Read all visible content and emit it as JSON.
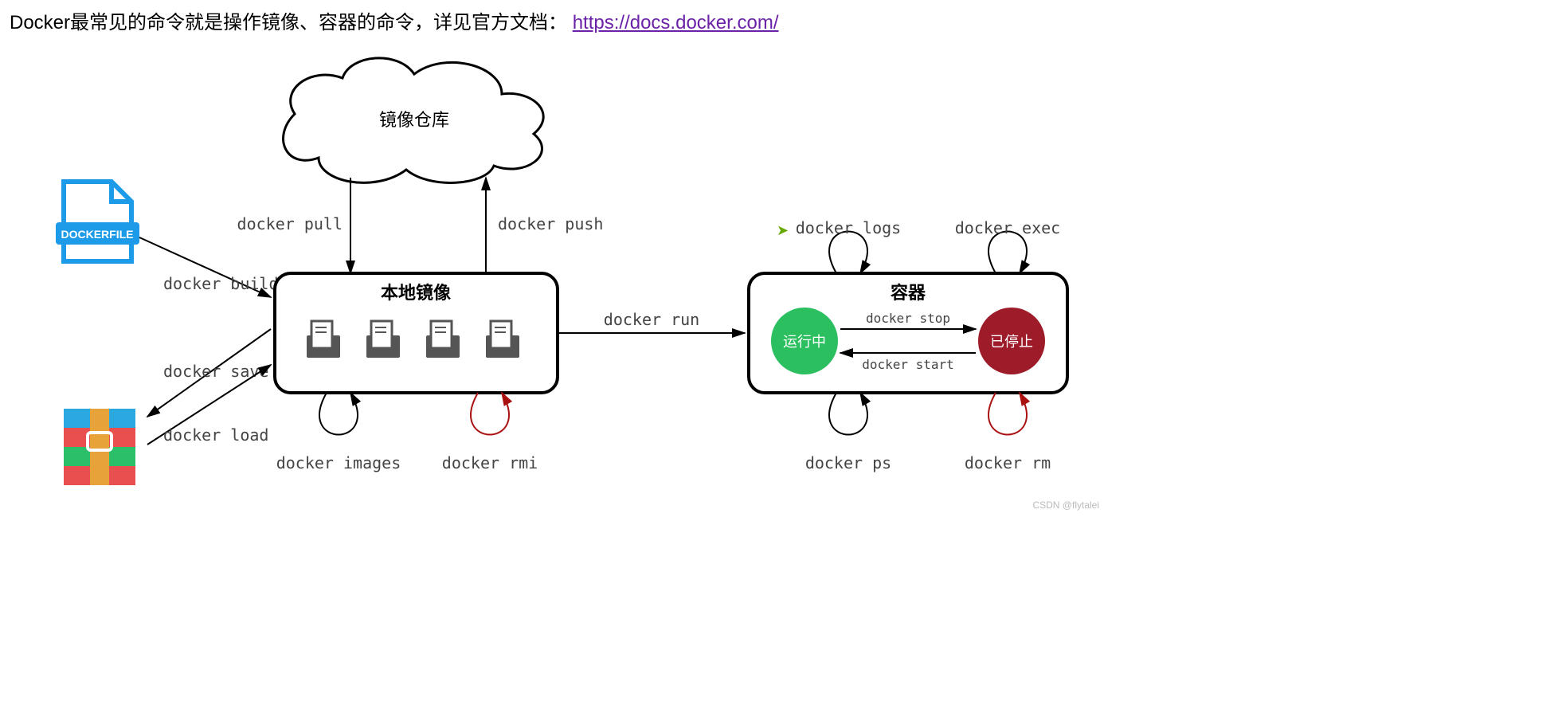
{
  "header": {
    "intro_text": "Docker最常见的命令就是操作镜像、容器的命令，详见官方文档：",
    "link_text": " https://docs.docker.com/"
  },
  "nodes": {
    "dockerfile_label": "DOCKERFILE",
    "registry_label": "镜像仓库",
    "local_images_label": "本地镜像",
    "container_label": "容器",
    "state_running": "运行中",
    "state_stopped": "已停止"
  },
  "commands": {
    "build": "docker build",
    "save": "docker save",
    "load": "docker load",
    "pull": "docker pull",
    "push": "docker push",
    "images": "docker images",
    "rmi": "docker rmi",
    "run": "docker run",
    "logs": "docker logs",
    "exec": "docker exec",
    "stop": "docker stop",
    "start": "docker start",
    "ps": "docker ps",
    "rm": "docker rm"
  },
  "watermark": "CSDN @flytalei"
}
